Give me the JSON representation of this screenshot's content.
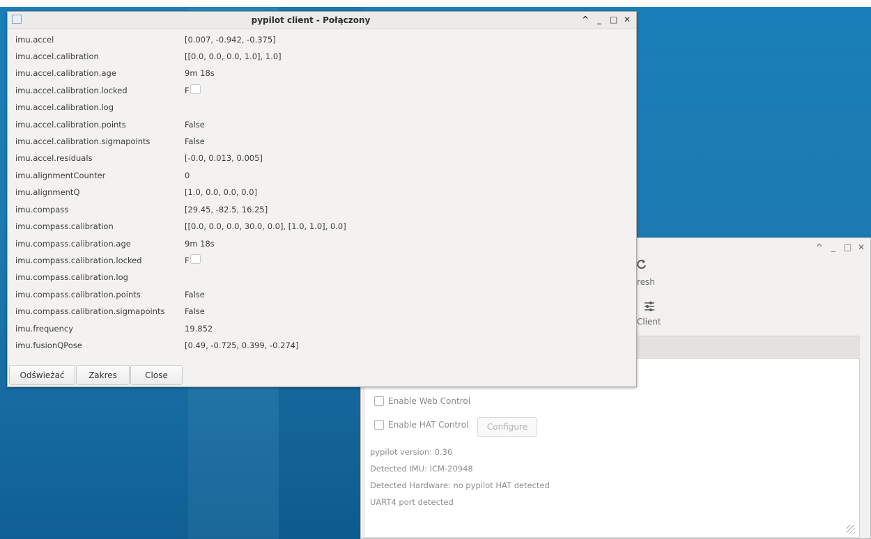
{
  "main_window": {
    "title": "pypilot client - Połączony",
    "rows": [
      {
        "key": "imu.accel",
        "value": "[0.007, -0.942, -0.375]"
      },
      {
        "key": "imu.accel.calibration",
        "value": "[[0.0, 0.0, 0.0, 1.0], 1.0]"
      },
      {
        "key": "imu.accel.calibration.age",
        "value": "9m 18s"
      },
      {
        "key": "imu.accel.calibration.locked",
        "checkbox_text": "F  se",
        "checked": false
      },
      {
        "key": "imu.accel.calibration.log",
        "value": ""
      },
      {
        "key": "imu.accel.calibration.points",
        "value": "False"
      },
      {
        "key": "imu.accel.calibration.sigmapoints",
        "value": "False"
      },
      {
        "key": "imu.accel.residuals",
        "value": "[-0.0, 0.013, 0.005]"
      },
      {
        "key": "imu.alignmentCounter",
        "value": "0"
      },
      {
        "key": "imu.alignmentQ",
        "value": "[1.0, 0.0, 0.0, 0.0]"
      },
      {
        "key": "imu.compass",
        "value": "[29.45, -82.5, 16.25]"
      },
      {
        "key": "imu.compass.calibration",
        "value": "[[0.0, 0.0, 0.0, 30.0, 0.0], [1.0, 1.0], 0.0]"
      },
      {
        "key": "imu.compass.calibration.age",
        "value": "9m 18s"
      },
      {
        "key": "imu.compass.calibration.locked",
        "checkbox_text": "F  se",
        "checked": false
      },
      {
        "key": "imu.compass.calibration.log",
        "value": ""
      },
      {
        "key": "imu.compass.calibration.points",
        "value": "False"
      },
      {
        "key": "imu.compass.calibration.sigmapoints",
        "value": "False"
      },
      {
        "key": "imu.frequency",
        "value": "19.852"
      },
      {
        "key": "imu.fusionQPose",
        "value": "[0.49, -0.725, 0.399, -0.274]"
      }
    ],
    "buttons": {
      "refresh": "Odświeżać",
      "range": "Zakres",
      "close": "Close"
    },
    "controls": {
      "up": "^",
      "minimize": "_",
      "maximize": "□",
      "close": "✕"
    }
  },
  "back_window": {
    "toolbar": {
      "refresh_label": "resh",
      "client_label": "Client"
    },
    "controls": {
      "up": "^",
      "minimize": "_",
      "maximize": "□",
      "close": "✕"
    },
    "checkboxes": {
      "web_control": "Enable Web Control",
      "hat_control": "Enable HAT Control"
    },
    "configure_button": "Configure",
    "info": {
      "version": "pypilot version: 0.36",
      "imu": "Detected IMU: ICM-20948",
      "hardware": "Detected Hardware: no pypilot HAT detected",
      "uart": "UART4 port detected"
    }
  }
}
